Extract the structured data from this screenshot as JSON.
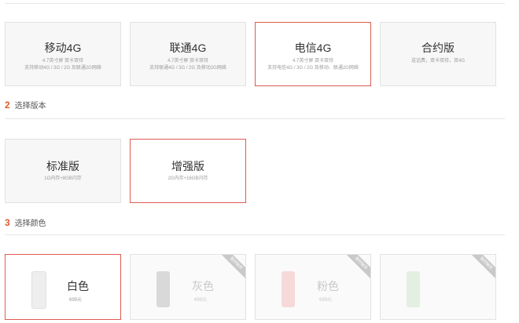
{
  "networks": [
    {
      "title": "移动4G",
      "line1": "4.7英寸屏 双卡双待",
      "line2": "支持移动4G / 3G / 2G 及联通2G网络",
      "selected": false
    },
    {
      "title": "联通4G",
      "line1": "4.7英寸屏 双卡双待",
      "line2": "支持联通4G / 3G / 2G 及移动2G网络",
      "selected": false
    },
    {
      "title": "电信4G",
      "line1": "4.7英寸屏 双卡双待",
      "line2": "支持电信4G / 3G / 2G 及移动、联通2G网络",
      "selected": true
    },
    {
      "title": "合约版",
      "line1": "送话费，双卡双待，双4G",
      "line2": "",
      "selected": false
    }
  ],
  "step2": {
    "num": "2",
    "label": "选择版本"
  },
  "versions": [
    {
      "title": "标准版",
      "spec": "1G内存+8GB闪存",
      "selected": false
    },
    {
      "title": "增强版",
      "spec": "2G内存+16GB闪存",
      "selected": true
    }
  ],
  "step3": {
    "num": "3",
    "label": "选择颜色"
  },
  "colors": [
    {
      "name": "白色",
      "price": "699元",
      "selected": true,
      "disabled": false,
      "phone_color": "#eeeeee",
      "badge": ""
    },
    {
      "name": "灰色",
      "price": "699元",
      "selected": false,
      "disabled": true,
      "phone_color": "#d9d9d9",
      "badge": "暂时缺货"
    },
    {
      "name": "粉色",
      "price": "699元",
      "selected": false,
      "disabled": true,
      "phone_color": "#f6dada",
      "badge": "暂时缺货"
    },
    {
      "name": "",
      "price": "",
      "selected": false,
      "disabled": true,
      "phone_color": "#e3efe0",
      "badge": "暂时缺货"
    }
  ]
}
